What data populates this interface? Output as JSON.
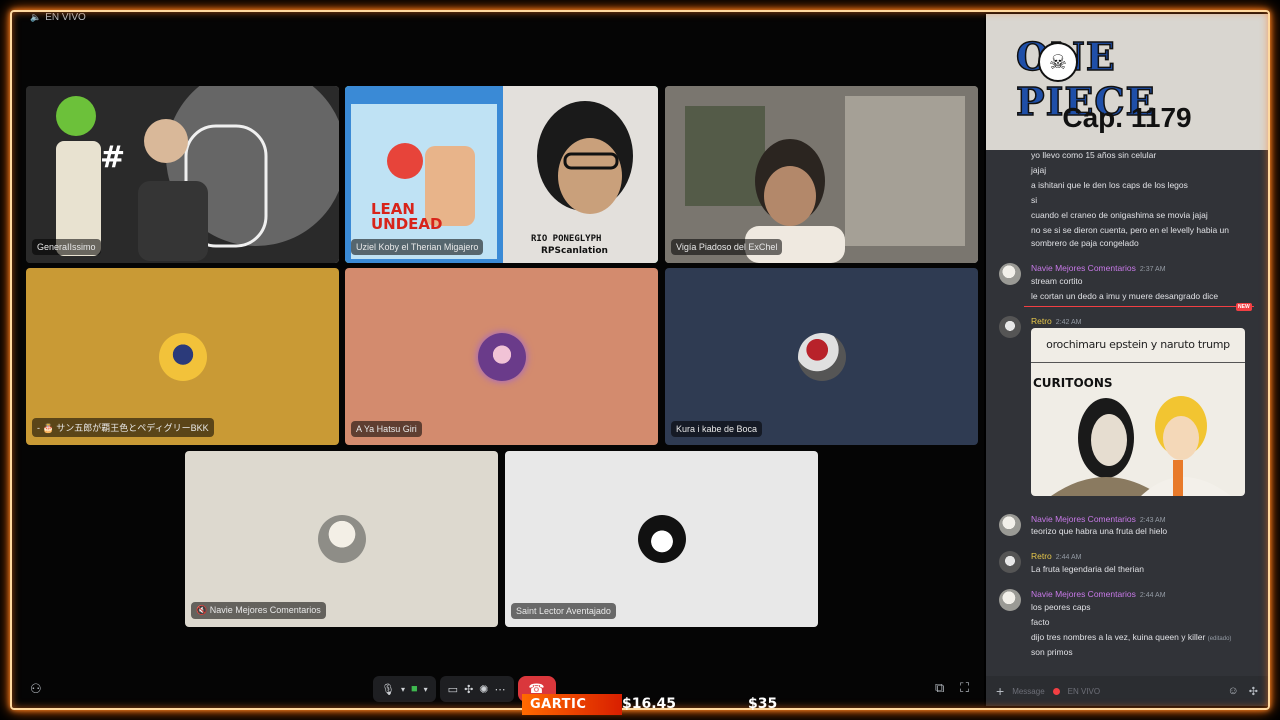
{
  "top_status": {
    "live_label": "EN VIVO"
  },
  "tiles": [
    {
      "name": "GeneraIIssimo",
      "type": "video"
    },
    {
      "name": "Uziel Koby el Therian Migajero",
      "type": "video",
      "overlay": {
        "blu_ray_title": "LEAN UNDEAD",
        "credit_top": "RIO PONEGLYPH",
        "credit_bottom": "RPScanlation"
      }
    },
    {
      "name": "Vigía Piadoso del ExChel",
      "type": "video"
    },
    {
      "name": "- 🎂 サン五郎が覇王色とペディグリーBKK",
      "type": "avatar",
      "color": "#c99a35"
    },
    {
      "name": "A Ya Hatsu Giri",
      "type": "avatar",
      "color": "#d38b6e"
    },
    {
      "name": "Kura i kabe de Boca",
      "type": "avatar",
      "color": "#2f3b52"
    },
    {
      "name": "🔇 Navie Mejores Comentarios",
      "type": "avatar",
      "color": "#ddd9cf"
    },
    {
      "name": "Saint Lector Aventajado",
      "type": "avatar",
      "color": "#e8e8e8"
    }
  ],
  "zoro_badge": "#",
  "ticker": {
    "name": "GARTIC",
    "amount": "$16.45",
    "amount2": "$35"
  },
  "logo": {
    "word": "ONE PIECE",
    "chapter": "Cap. 1179"
  },
  "chat": {
    "lines_top": [
      "yo llevo como 15 años sin celular",
      "jajaj",
      "a ishitani que le den los caps de los legos",
      "si",
      "cuando el craneo de onigashima se movia jajaj",
      "no se si se dieron cuenta, pero en el levelly habia un",
      "sombrero de paja congelado"
    ],
    "msg1": {
      "author": "Navie Mejores Comentarios",
      "time": "2:37 AM",
      "lines": [
        "stream cortito",
        "le cortan un dedo a imu y muere desangrado dice"
      ]
    },
    "new_badge": "NEW",
    "msg2": {
      "author": "Retro",
      "time": "2:42 AM",
      "meme_caption": "orochimaru epstein y naruto trump",
      "meme_brand": "CURITOONS"
    },
    "msg3": {
      "author": "Navie Mejores Comentarios",
      "time": "2:43 AM",
      "lines": [
        "teorizo que habra una fruta del hielo"
      ]
    },
    "msg4": {
      "author": "Retro",
      "time": "2:44 AM",
      "lines": [
        "La fruta legendaria del therian"
      ]
    },
    "msg5": {
      "author": "Navie Mejores Comentarios",
      "time": "2:44 AM",
      "lines": [
        "los peores caps",
        "facto",
        "dijo tres nombres a la vez, kuina queen y killer",
        "son primos"
      ],
      "edited": "(editado)"
    },
    "input": {
      "placeholder": "Message",
      "live_label": "EN VIVO"
    }
  },
  "colors": {
    "accent_frame": "#ff7a1a",
    "end_call": "#da373c",
    "navie": "#c879e8",
    "retro": "#e6c74a"
  }
}
